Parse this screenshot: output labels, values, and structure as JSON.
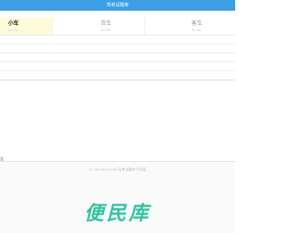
{
  "header": {
    "title": "驾考试题库"
  },
  "tabs": [
    {
      "name": "小车",
      "code": "C1 C2",
      "active": true
    },
    {
      "name": "货车",
      "code": "A2 B2",
      "active": false
    },
    {
      "name": "客车",
      "code": "A1 B1",
      "active": false
    }
  ],
  "bottom_note": "全",
  "footer": {
    "text": "KL.JKXXFB.COM 驾考试题库手机版",
    "watermark": "便民库"
  },
  "colors": {
    "header": "#3a9fe3",
    "active_tab": "#fffbd9",
    "watermark": "#2fc4a0"
  }
}
